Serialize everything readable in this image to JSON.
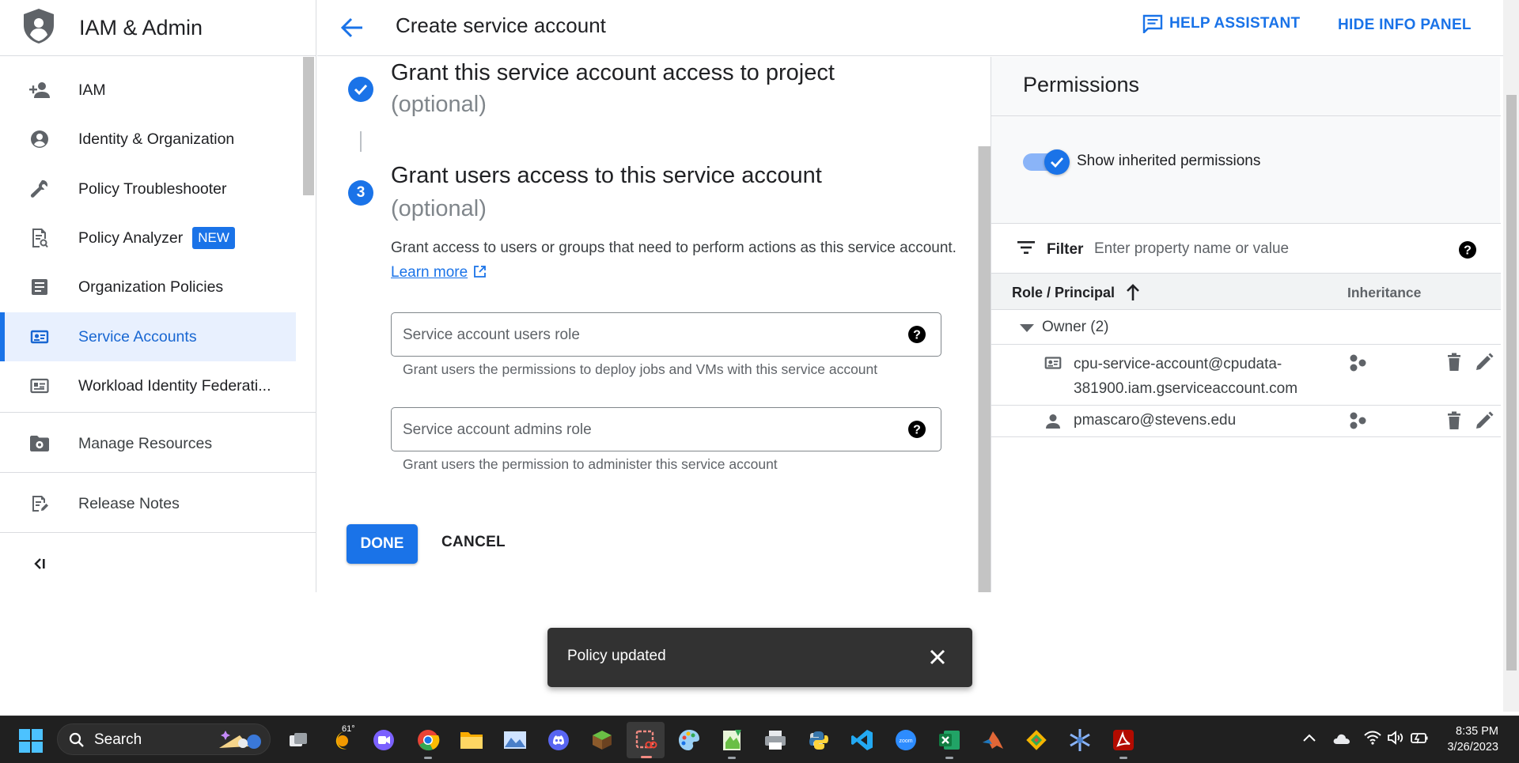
{
  "sidebar": {
    "title": "IAM & Admin",
    "items": [
      {
        "label": "IAM",
        "icon": "person-add-icon"
      },
      {
        "label": "Identity & Organization",
        "icon": "account-circle-icon"
      },
      {
        "label": "Policy Troubleshooter",
        "icon": "wrench-icon"
      },
      {
        "label": "Policy Analyzer",
        "icon": "policy-doc-search-icon",
        "badge": "NEW"
      },
      {
        "label": "Organization Policies",
        "icon": "list-doc-icon"
      },
      {
        "label": "Service Accounts",
        "icon": "service-account-icon",
        "active": true
      },
      {
        "label": "Workload Identity Federati...",
        "icon": "id-card-icon"
      },
      {
        "label": "Manage Resources",
        "icon": "folder-gear-icon"
      },
      {
        "label": "Release Notes",
        "icon": "notes-edit-icon"
      }
    ],
    "collapse_label": "<I"
  },
  "header": {
    "title": "Create service account",
    "help_label": "HELP ASSISTANT",
    "hide_label": "HIDE INFO PANEL"
  },
  "steps": {
    "step2_title": "Grant this service account access to project",
    "step2_optional": "(optional)",
    "step3_number": "3",
    "step3_title": "Grant users access to this service account",
    "step3_optional": "(optional)",
    "description": "Grant access to users or groups that need to perform actions as this service account.",
    "learn_more": "Learn more",
    "users_role_placeholder": "Service account users role",
    "users_role_hint": "Grant users the permissions to deploy jobs and VMs with this service account",
    "admins_role_placeholder": "Service account admins role",
    "admins_role_hint": "Grant users the permission to administer this service account",
    "done_label": "DONE",
    "cancel_label": "CANCEL"
  },
  "panel": {
    "title": "Permissions",
    "toggle_label": "Show inherited permissions",
    "toggle_on": true,
    "filter_label": "Filter",
    "filter_placeholder": "Enter property name or value",
    "col_role": "Role / Principal",
    "col_inheritance": "Inheritance",
    "group_label": "Owner (2)",
    "principals": [
      {
        "line1": "cpu-service-account@cpudata-",
        "line2": "381900.iam.gserviceaccount.com",
        "icon": "service-account-icon"
      },
      {
        "line1": "pmascaro@stevens.edu",
        "line2": "",
        "icon": "person-icon"
      }
    ]
  },
  "snackbar": {
    "message": "Policy updated"
  },
  "taskbar": {
    "search_label": "Search",
    "weather_temp": "61°",
    "time": "8:35 PM",
    "date": "3/26/2023"
  },
  "colors": {
    "accent": "#1a73e8",
    "active_bg": "#e8f0fe",
    "snackbar_bg": "#323232",
    "taskbar_bg": "#202020"
  }
}
